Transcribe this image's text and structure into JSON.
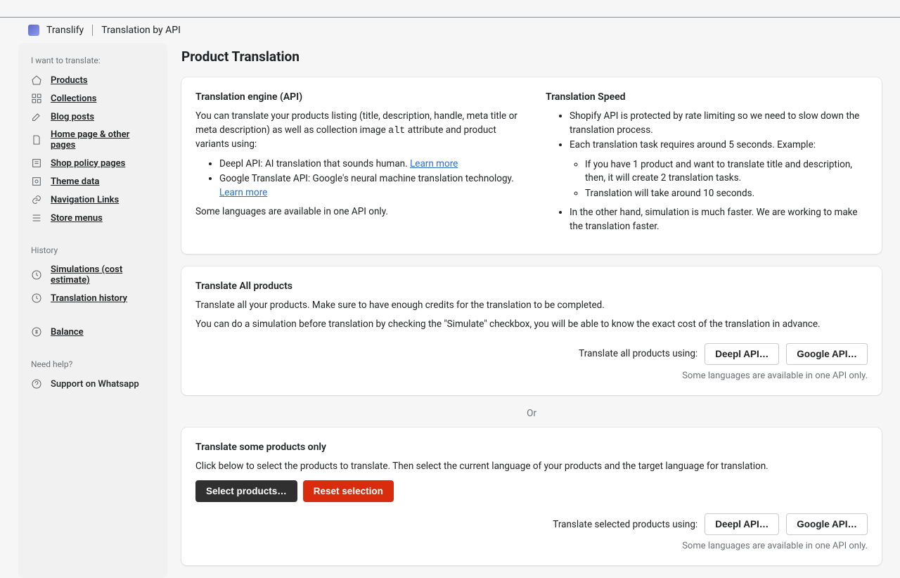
{
  "header": {
    "appName": "Translify",
    "appSub": "Translation by API"
  },
  "sidebar": {
    "group1": {
      "heading": "I want to translate:",
      "items": [
        "Products",
        "Collections",
        "Blog posts",
        "Home page & other pages",
        "Shop policy pages",
        "Theme data",
        "Navigation Links",
        "Store menus"
      ]
    },
    "group2": {
      "heading": "History",
      "items": [
        "Simulations (cost estimate)",
        "Translation history"
      ]
    },
    "group3": {
      "items": [
        "Balance"
      ]
    },
    "group4": {
      "heading": "Need help?",
      "items": [
        "Support on Whatsapp"
      ]
    }
  },
  "page": {
    "title": "Product Translation",
    "engine": {
      "heading": "Translation engine (API)",
      "p1a": "You can translate your products listing (title, description, handle, meta title or meta description) as well as collection image ",
      "alt": "alt",
      "p1b": " attribute and product variants using:",
      "b1": "Deepl API: AI translation that sounds human. ",
      "b2": "Google Translate API: Google's neural machine translation technology. ",
      "learn": "Learn more",
      "note": "Some languages are available in one API only."
    },
    "speed": {
      "heading": "Translation Speed",
      "b1": "Shopify API is protected by rate limiting so we need to slow down the translation process.",
      "b2": "Each translation task requires around 5 seconds. Example:",
      "s1": "If you have 1 product and want to translate title and description, then, it will create 2 translation tasks.",
      "s2": "Translation will take around 10 seconds.",
      "b3": "In the other hand, simulation is much faster. We are working to make the translation faster."
    },
    "all": {
      "heading": "Translate All products",
      "p1": "Translate all your products. Make sure to have enough credits for the translation to be completed.",
      "p2": "You can do a simulation before translation by checking the \"Simulate\" checkbox, you will be able to know the exact cost of the translation in advance.",
      "lead": "Translate all products using:",
      "btn1": "Deepl API…",
      "btn2": "Google API…",
      "note": "Some languages are available in one API only."
    },
    "or": "Or",
    "some": {
      "heading": "Translate some products only",
      "p1": "Click below to select the products to translate. Then select the current language of your products and the target language for translation.",
      "btn1": "Select products…",
      "btn2": "Reset selection",
      "lead": "Translate selected products using:",
      "btn3": "Deepl API…",
      "btn4": "Google API…",
      "note": "Some languages are available in one API only."
    }
  }
}
